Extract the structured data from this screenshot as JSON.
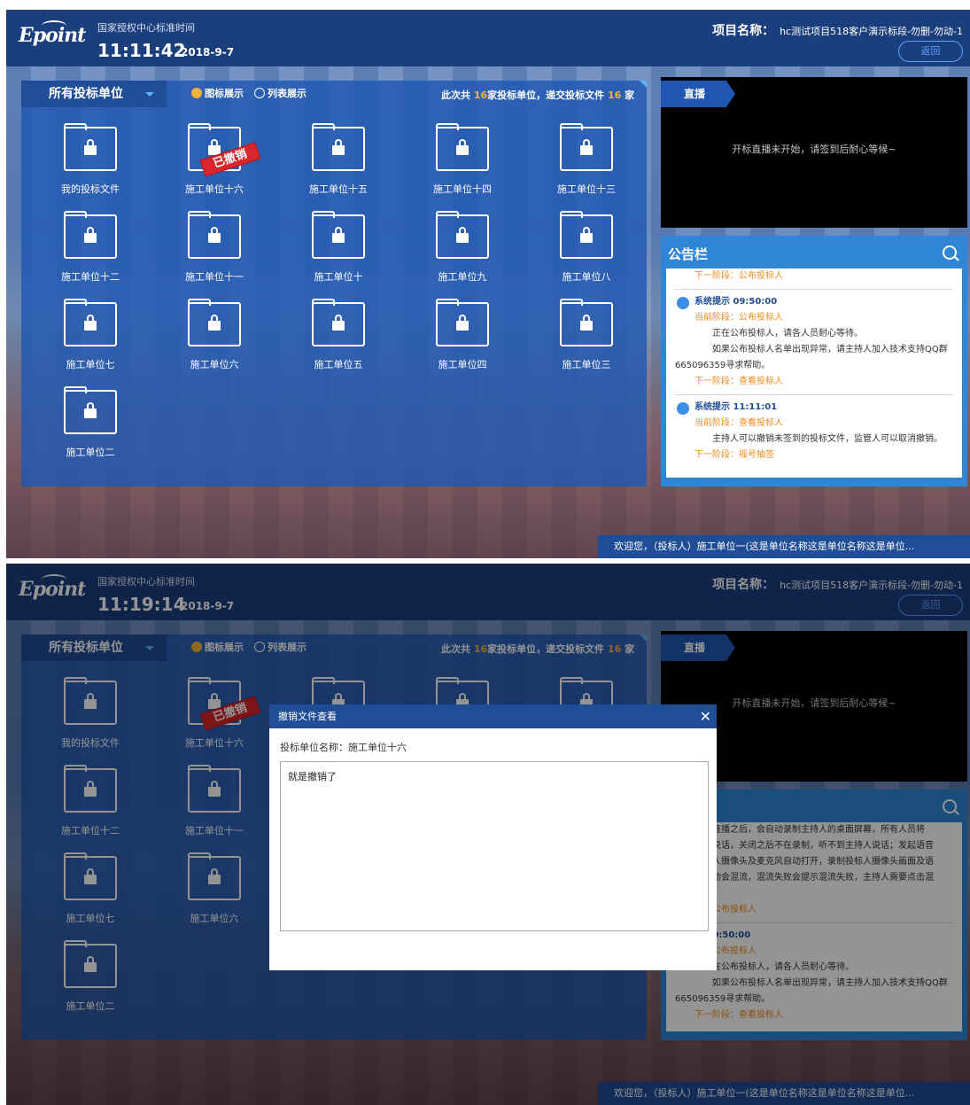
{
  "header": {
    "logo": "Epoint",
    "time_caption": "国家授权中心标准时间",
    "project_label": "项目名称：",
    "project_name": "hc测试项目518客户演示标段-勿删-勿动-1",
    "back_label": "返回"
  },
  "screens": [
    {
      "time": "11:11:42",
      "date": "2018-9-7"
    },
    {
      "time": "11:19:14",
      "date": "2018-9-7"
    }
  ],
  "panel": {
    "dropdown_label": "所有投标单位",
    "view_icon": "图标展示",
    "view_list": "列表展示",
    "count_prefix": "此次共 ",
    "bidder_count": "16",
    "count_mid": "家投标单位，递交投标文件 ",
    "file_count": "16",
    "count_suffix": " 家",
    "revoked_stamp": "已撤销"
  },
  "folders_s1": [
    "我的投标文件",
    "施工单位十六",
    "施工单位十五",
    "施工单位十四",
    "施工单位十三",
    "施工单位十二",
    "施工单位十一",
    "施工单位十",
    "施工单位九",
    "施工单位八",
    "施工单位七",
    "施工单位六",
    "施工单位五",
    "施工单位四",
    "施工单位三",
    "施工单位二"
  ],
  "live": {
    "tab": "直播",
    "message": "开标直播未开始，请签到后耐心等候~"
  },
  "notice": {
    "title": "公告栏",
    "s1": {
      "l1": "下一阶段：公布投标人",
      "h1": "系统提示 09:50:00",
      "c1": "当前阶段：公布投标人",
      "t1a": "正在公布投标人，请各人员耐心等待。",
      "t1b": "如果公布投标人名单出现异常，请主持人加入技术支持QQ群",
      "t1c": "665096359寻求帮助。",
      "n1": "下一阶段：查看投标人",
      "h2": "系统提示 11:11:01",
      "c2": "当前阶段：查看投标人",
      "t2": "主持人可以撤销未签到的投标文件，监管人可以取消撤销。",
      "n2": "下一阶段：摇号抽签"
    },
    "s2": {
      "p1": "打开直播之后，会自动录制主持人的桌面屏幕，所有人员将",
      "p2": "持人说话，关闭之后不在录制，听不到主持人说话；发起语音",
      "p3": "投标人摄像头及麦克风自动打开，录制投标人摄像头画面及语",
      "p4": "音互动会混流，混流失败会提示混流失败，主持人需要点击混",
      "p5": "l：",
      "p6": "段：公布投标人",
      "p7": "示 09:50:00",
      "p8": "段：公布投标人",
      "p9": "在公布投标人，请各人员耐心等待。",
      "p10": "如果公布投标人名单出现异常，请主持人加入技术支持QQ群",
      "p11": "665096359寻求帮助。",
      "p12": "下一阶段：查看投标人"
    }
  },
  "welcome": "欢迎您，（投标人）施工单位一(这是单位名称这是单位名称这是单位...",
  "welcome2": "欢迎您，（投标人）施工单位一(这是单位名称这是单位名称这是单位...",
  "modal": {
    "title": "撤销文件查看",
    "bidder_label": "投标单位名称：施工单位十六",
    "content": "就是撤销了"
  }
}
